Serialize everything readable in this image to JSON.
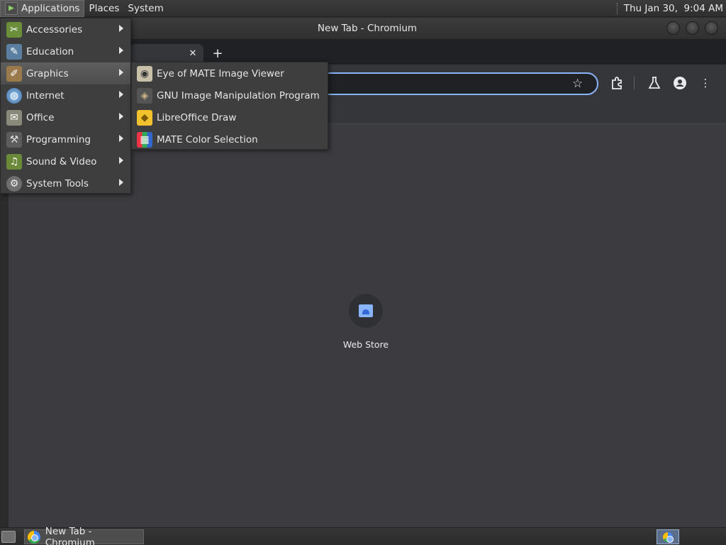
{
  "top_panel": {
    "applications_label": "Applications",
    "places_label": "Places",
    "system_label": "System",
    "clock": "Thu Jan 30,  9:04 AM"
  },
  "window": {
    "title": "New Tab - Chromium",
    "tab_close": "✕",
    "new_tab": "+"
  },
  "content": {
    "shortcut_label": "Web Store"
  },
  "apps_menu": {
    "items": [
      {
        "label": "Accessories",
        "icon": "accessories-icon"
      },
      {
        "label": "Education",
        "icon": "education-icon"
      },
      {
        "label": "Graphics",
        "icon": "graphics-icon"
      },
      {
        "label": "Internet",
        "icon": "internet-icon"
      },
      {
        "label": "Office",
        "icon": "office-icon"
      },
      {
        "label": "Programming",
        "icon": "programming-icon"
      },
      {
        "label": "Sound & Video",
        "icon": "sound-video-icon"
      },
      {
        "label": "System Tools",
        "icon": "system-tools-icon"
      }
    ],
    "hovered": "Graphics"
  },
  "graphics_submenu": {
    "items": [
      {
        "label": "Eye of MATE Image Viewer",
        "icon": "image-viewer-icon"
      },
      {
        "label": "GNU Image Manipulation Program",
        "icon": "gimp-icon"
      },
      {
        "label": "LibreOffice Draw",
        "icon": "libreoffice-draw-icon"
      },
      {
        "label": "MATE Color Selection",
        "icon": "color-selection-icon"
      }
    ]
  },
  "taskbar": {
    "window_label": "New Tab - Chromium"
  },
  "colors": {
    "accent": "#8ab4f8",
    "panel": "#333333",
    "menu_bg": "#3e3e3e"
  }
}
